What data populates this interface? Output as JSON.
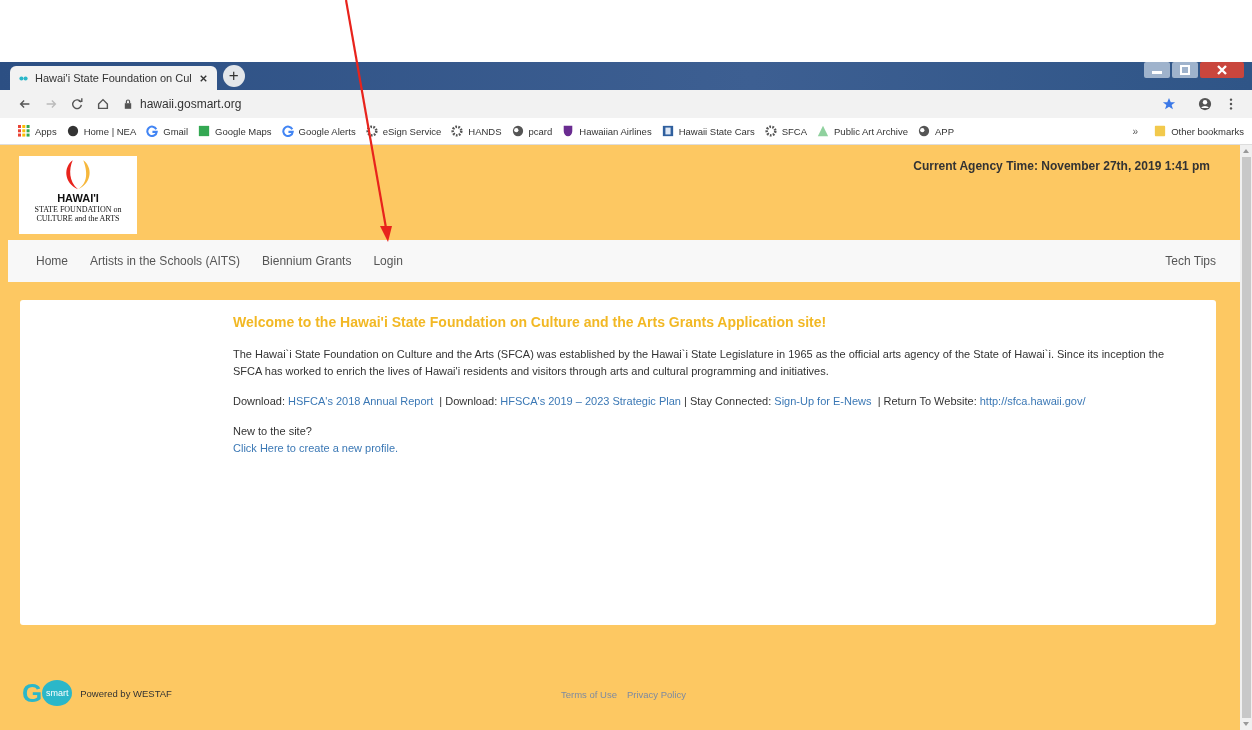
{
  "browser": {
    "tab_title": "Hawai'i State Foundation on Cul",
    "new_tab": "+",
    "url": "hawaii.gosmart.org",
    "bookmarks": [
      {
        "label": "Apps",
        "kind": "grid"
      },
      {
        "label": "Home | NEA",
        "kind": "disc"
      },
      {
        "label": "Gmail",
        "kind": "g"
      },
      {
        "label": "Google Maps",
        "kind": "map"
      },
      {
        "label": "Google Alerts",
        "kind": "g"
      },
      {
        "label": "eSign Service",
        "kind": "gear"
      },
      {
        "label": "HANDS",
        "kind": "gear"
      },
      {
        "label": "pcard",
        "kind": "globe"
      },
      {
        "label": "Hawaiian Airlines",
        "kind": "shield"
      },
      {
        "label": "Hawaii State Cars",
        "kind": "sheet"
      },
      {
        "label": "SFCA",
        "kind": "gear"
      },
      {
        "label": "Public Art Archive",
        "kind": "leaf"
      },
      {
        "label": "APP",
        "kind": "globe"
      }
    ],
    "overflow": "»",
    "other_bookmarks": "Other bookmarks"
  },
  "header": {
    "logo_title": "HAWAI'I",
    "logo_subtitle_1": "STATE FOUNDATION on",
    "logo_subtitle_2": "CULTURE and the ARTS",
    "agency_time": "Current Agency Time: November 27th, 2019 1:41 pm"
  },
  "nav": {
    "items": [
      "Home",
      "Artists in the Schools (AITS)",
      "Biennium Grants",
      "Login"
    ],
    "right_item": "Tech Tips"
  },
  "content": {
    "heading": "Welcome to the Hawai'i State Foundation on Culture and the Arts Grants Application site!",
    "intro": "The Hawai`i State Foundation on Culture and the Arts (SFCA) was established by the Hawai`i State Legislature in 1965 as the official arts agency of the State of Hawai`i. Since its inception the SFCA has worked to enrich the lives of Hawai'i residents and visitors through arts and cultural programming and initiatives.",
    "links_line": [
      {
        "kind": "text",
        "text": "Download: "
      },
      {
        "kind": "link",
        "text": "HSFCA's 2018 Annual Report"
      },
      {
        "kind": "text",
        "text": "  | Download: "
      },
      {
        "kind": "link",
        "text": "HFSCA's 2019 – 2023 Strategic Plan"
      },
      {
        "kind": "text",
        "text": " | Stay Connected: "
      },
      {
        "kind": "link",
        "text": "Sign-Up for E-News"
      },
      {
        "kind": "text",
        "text": "  | Return To Website: "
      },
      {
        "kind": "link",
        "text": "http://sfca.hawaii.gov/"
      }
    ],
    "new_question": "New to the site?",
    "new_profile_link": "Click Here to create a new profile."
  },
  "footer": {
    "logo_letter": "G",
    "logo_badge": "smart",
    "powered_by": "Powered by WESTAF",
    "links": [
      "Terms of Use",
      "Privacy Policy"
    ]
  }
}
